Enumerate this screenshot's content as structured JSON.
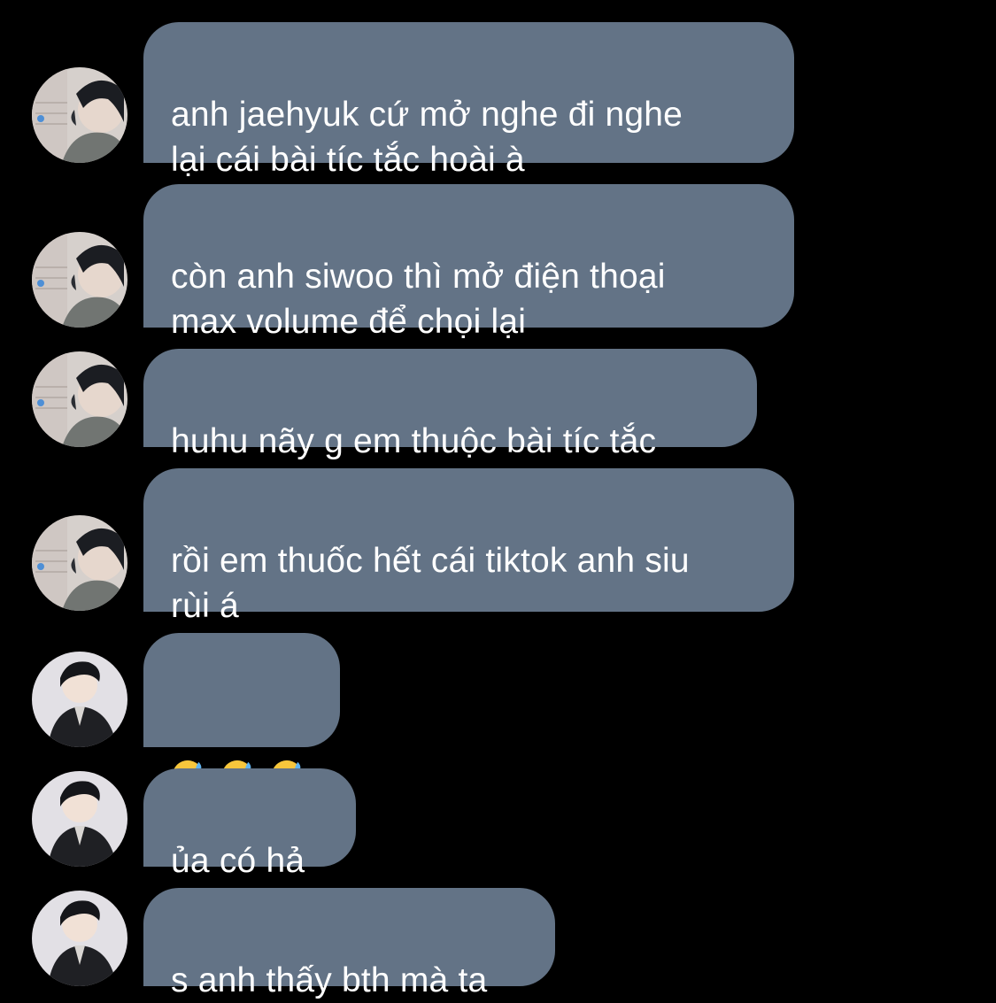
{
  "messages": [
    {
      "sender": "user-a",
      "text": "anh jaehyuk cứ mở nghe đi nghe\nlại cái bài tíc tắc hoài à"
    },
    {
      "sender": "user-a",
      "text": "còn anh siwoo thì mở điện thoại\nmax volume để chọi lại"
    },
    {
      "sender": "user-a",
      "text": "huhu nãy g em thuộc bài tíc tắc"
    },
    {
      "sender": "user-a",
      "text": "rồi em thuốc hết cái tiktok anh siu\nrùi á"
    },
    {
      "sender": "user-b",
      "emoji": [
        "grinning-sweat-emoji",
        "grinning-sweat-emoji",
        "grinning-sweat-emoji"
      ]
    },
    {
      "sender": "user-b",
      "text": "ủa có hả"
    },
    {
      "sender": "user-b",
      "text": "s anh thấy bth mà ta"
    }
  ],
  "colors": {
    "background": "#000000",
    "bubble": "#637386",
    "text": "#ffffff"
  }
}
